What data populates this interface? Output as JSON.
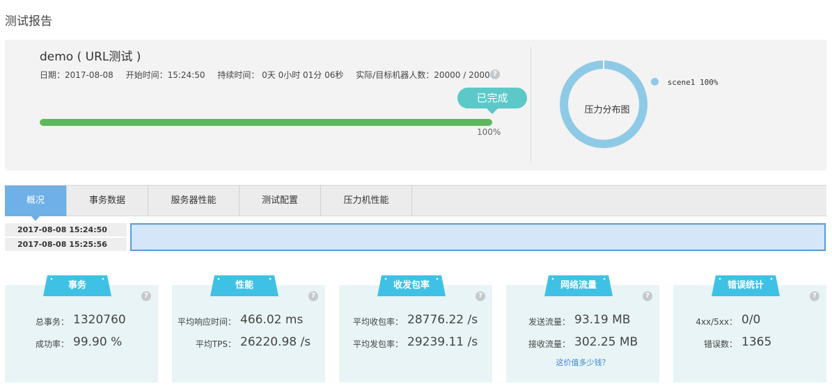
{
  "page": {
    "title": "测试报告"
  },
  "summary": {
    "test_name": "demo ( URL测试 )",
    "date": "日期：2017-08-08",
    "start_time": "开始时间：15:24:50",
    "duration": "持续时间： 0天 0小时 01分 06秒",
    "robots": "实际/目标机器人数：20000 / 20000",
    "help_symbol": "?",
    "status": "已完成",
    "progress_percent": 100,
    "progress_text": "100%",
    "donut_label": "压力分布图",
    "legend": [
      {
        "name": "scene1",
        "value": "100%",
        "color": "#8ecae6"
      }
    ]
  },
  "tabs": [
    {
      "label": "概况",
      "active": true
    },
    {
      "label": "事务数据",
      "active": false
    },
    {
      "label": "服务器性能",
      "active": false
    },
    {
      "label": "测试配置",
      "active": false
    },
    {
      "label": "压力机性能",
      "active": false
    }
  ],
  "timeline": {
    "start": "2017-08-08 15:24:50",
    "end": "2017-08-08 15:25:56"
  },
  "colors": {
    "accent": "#6fb0e6",
    "progress": "#5cb85c",
    "status": "#5cc8c8",
    "card_header": "#3fc1e6",
    "card_bg": "#e8f4f5"
  },
  "cards": [
    {
      "title": "事务",
      "rows": [
        {
          "label": "总事务：",
          "value": "1320760"
        },
        {
          "label": "成功率：",
          "value": "99.90 %"
        }
      ]
    },
    {
      "title": "性能",
      "rows": [
        {
          "label": "平均响应时间：",
          "value": "466.02 ms"
        },
        {
          "label": "平均TPS：",
          "value": "26220.98 /s"
        }
      ]
    },
    {
      "title": "收发包率",
      "rows": [
        {
          "label": "平均收包率：",
          "value": "28776.22 /s"
        },
        {
          "label": "平均发包率：",
          "value": "29239.11 /s"
        }
      ]
    },
    {
      "title": "网络流量",
      "rows": [
        {
          "label": "发送流量：",
          "value": "93.19 MB"
        },
        {
          "label": "接收流量：",
          "value": "302.25 MB"
        }
      ],
      "link": "这价值多少钱？"
    },
    {
      "title": "错误统计",
      "rows": [
        {
          "label": "4xx/5xx：",
          "value": "0/0"
        },
        {
          "label": "错误数：",
          "value": "1365"
        }
      ]
    }
  ]
}
